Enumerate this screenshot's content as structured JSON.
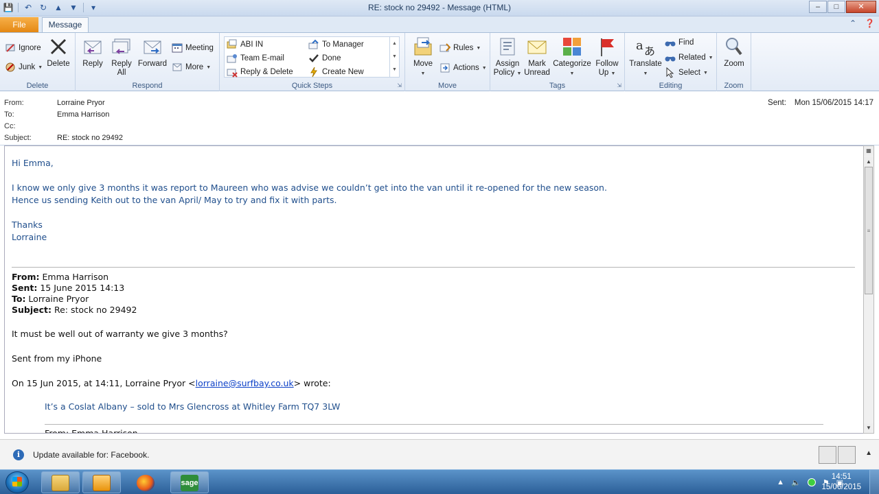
{
  "window": {
    "title": "RE: stock no 29492  -  Message (HTML)",
    "controls": {
      "minimize": "–",
      "maximize": "□",
      "close": "✕"
    }
  },
  "tabs": {
    "file": "File",
    "message": "Message"
  },
  "ribbon": {
    "delete_group": {
      "label": "Delete",
      "ignore": "Ignore",
      "junk": "Junk",
      "delete": "Delete"
    },
    "respond_group": {
      "label": "Respond",
      "reply": "Reply",
      "reply_all_line1": "Reply",
      "reply_all_line2": "All",
      "forward": "Forward",
      "meeting": "Meeting",
      "more": "More"
    },
    "quicksteps_group": {
      "label": "Quick Steps",
      "items": [
        "ABI IN",
        "Team E-mail",
        "Reply & Delete",
        "To Manager",
        "Done",
        "Create New"
      ]
    },
    "move_group": {
      "label": "Move",
      "move": "Move",
      "rules": "Rules",
      "actions": "Actions"
    },
    "tags_group": {
      "label": "Tags",
      "assign_line1": "Assign",
      "assign_line2": "Policy",
      "mark_line1": "Mark",
      "mark_line2": "Unread",
      "categorize": "Categorize",
      "follow_line1": "Follow",
      "follow_line2": "Up"
    },
    "editing_group": {
      "label": "Editing",
      "translate": "Translate",
      "find": "Find",
      "related": "Related",
      "select": "Select"
    },
    "zoom_group": {
      "label": "Zoom",
      "zoom": "Zoom"
    }
  },
  "header": {
    "from_label": "From:",
    "from_value": "Lorraine Pryor",
    "to_label": "To:",
    "to_value": "Emma Harrison",
    "cc_label": "Cc:",
    "cc_value": "",
    "subject_label": "Subject:",
    "subject_value": "RE: stock no 29492",
    "sent_label": "Sent:",
    "sent_value": "Mon 15/06/2015 14:17"
  },
  "body": {
    "greeting": "Hi Emma,",
    "line1": "I know we only give 3 months it was report to Maureen who was  advise we couldn’t get into the van until  it re-opened for the new season.",
    "line2": "Hence us sending Keith out to the van April/ May to try and fix it with parts.",
    "thanks": "Thanks",
    "signoff": "Lorraine",
    "quoted_header": {
      "from_label": "From:",
      "from_value": " Emma Harrison",
      "sent_label": "Sent:",
      "sent_value": " 15 June 2015 14:13",
      "to_label": "To:",
      "to_value": " Lorraine Pryor",
      "subject_label": "Subject:",
      "subject_value": " Re: stock no 29492"
    },
    "reply1": "It must be well out of warranty we give 3 months?",
    "reply2": "Sent from my iPhone",
    "on_prefix": "On 15 Jun 2015, at 14:11, Lorraine Pryor <",
    "on_email": "lorraine@surfbay.co.uk",
    "on_suffix": "> wrote:",
    "nested1": "It’s a Coslat Albany – sold to Mrs Glencross at Whitley Farm TQ7 3LW",
    "nested_from_cut": "From: Emma Harrison"
  },
  "notification": {
    "text": "Update available for: Facebook."
  },
  "taskbar": {
    "time": "14:51",
    "date": "15/06/2015",
    "apps": [
      "file-explorer-icon",
      "outlook-icon",
      "firefox-icon",
      "sage-icon"
    ],
    "sage_label": "sage"
  },
  "colors": {
    "body_blue": "#1f4e8c",
    "file_tab": "#e48814",
    "taskbar": "#2b5f98"
  }
}
